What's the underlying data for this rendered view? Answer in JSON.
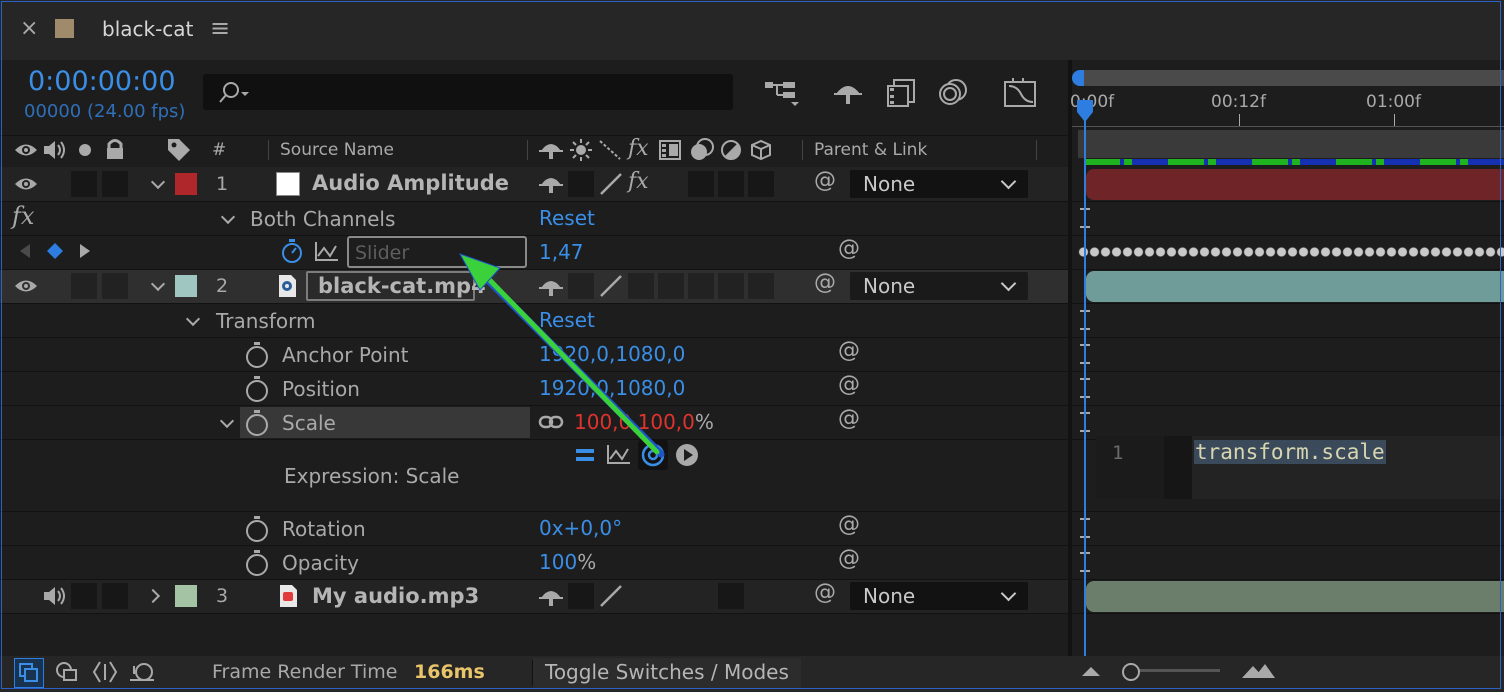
{
  "panel": {
    "title": "black-cat",
    "close": "×",
    "menu": "≡"
  },
  "timecode": {
    "main": "0:00:00:00",
    "sub": "00000 (24.00 fps)"
  },
  "search": {
    "placeholder": "",
    "icon": "search-icon"
  },
  "columns": {
    "hash": "#",
    "source_name": "Source Name",
    "parent_link": "Parent & Link",
    "fx": "fx"
  },
  "layers": [
    {
      "number": "1",
      "name": "Audio Amplitude",
      "parent": "None",
      "label_color": "#b0272b"
    },
    {
      "number": "2",
      "name": "black-cat.mp4",
      "parent": "None",
      "label_color": "#9fc6c1"
    },
    {
      "number": "3",
      "name": "My audio.mp3",
      "parent": "None",
      "label_color": "#a4c3a4"
    }
  ],
  "effect": {
    "name": "Both Channels",
    "reset": "Reset",
    "fx_badge": "fx",
    "slider_placeholder": "Slider",
    "slider_value": "1,47"
  },
  "transform": {
    "name": "Transform",
    "reset": "Reset",
    "anchor_label": "Anchor Point",
    "anchor_x": "1920,0",
    "anchor_y": "1080,0",
    "position_label": "Position",
    "position_x": "1920,0",
    "position_y": "1080,0",
    "scale_label": "Scale",
    "scale_x": "100,0",
    "scale_y": "100,0",
    "scale_unit": "%",
    "expression_label": "Expression: Scale",
    "rotation_label": "Rotation",
    "rotation_value": "0x+0,0°",
    "opacity_label": "Opacity",
    "opacity_value": "100",
    "opacity_unit": "%"
  },
  "timeline": {
    "ticks": [
      "0:00f",
      "00:12f",
      "01:00f"
    ],
    "expression_line_no": "1",
    "expression_code": "transform.scale"
  },
  "footer": {
    "render_label": "Frame Render Time",
    "render_value": "166ms",
    "toggle_label": "Toggle Switches / Modes"
  },
  "colors": {
    "accent": "#3a8ee6",
    "render_time": "#e8c46a",
    "layer1_bar": "#6f2428",
    "layer2_bar": "#6f9c98",
    "layer3_bar": "#6b7d6b",
    "arrow": "#3ad13a"
  }
}
